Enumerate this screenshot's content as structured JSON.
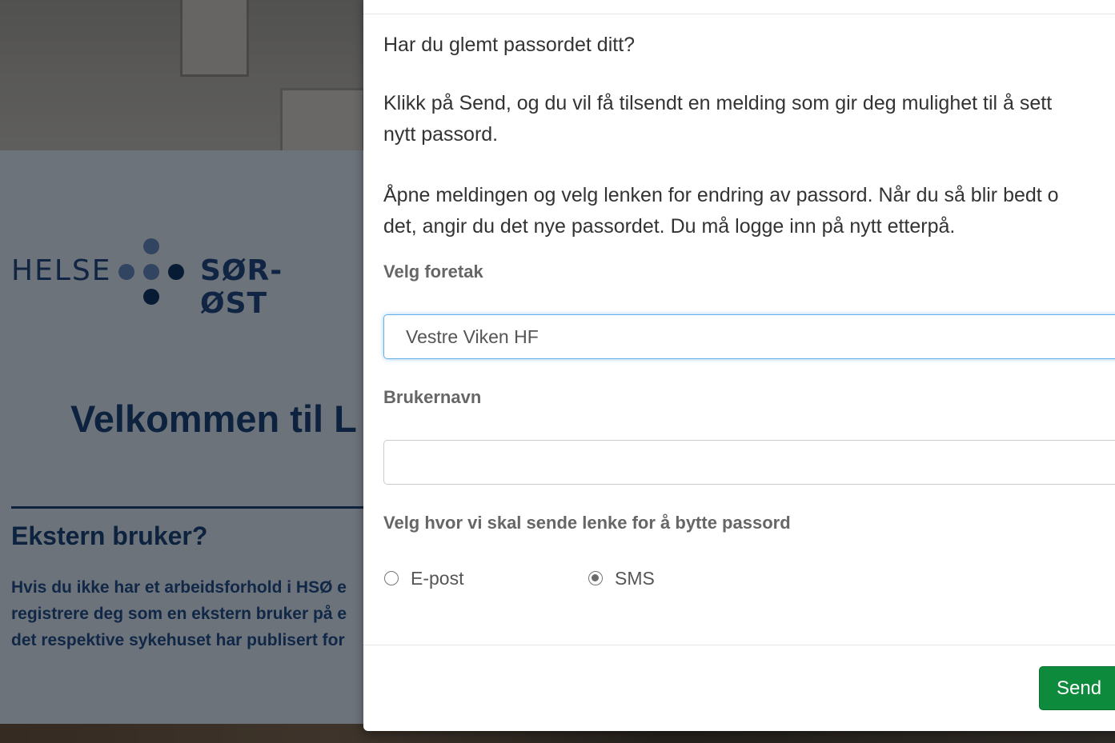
{
  "background": {
    "logo_left": "HELSE",
    "logo_right": "SØR-ØST",
    "welcome_heading": "Velkommen til L",
    "ekstern_heading": "Ekstern bruker?",
    "ekstern_lines": [
      "Hvis du ikke har et arbeidsforhold i HSØ e",
      "registrere deg som en ekstern bruker på e",
      "det respektive sykehuset har publisert for"
    ],
    "colors": {
      "brand_blue": "#153b6c",
      "logo_dot_dark": "#0f2f5c",
      "logo_dot_light": "#5577a5"
    }
  },
  "modal": {
    "question": "Har du glemt passordet ditt?",
    "paragraph1_line1": "Klikk på Send, og du vil få tilsendt en melding som gir deg mulighet til å sett",
    "paragraph1_line2": "nytt passord.",
    "paragraph2_line1": "Åpne meldingen og velg lenken for endring av passord. Når du så blir bedt o",
    "paragraph2_line2": "det, angir du det nye passordet. Du må logge inn på nytt etterpå.",
    "foretak_label": "Velg foretak",
    "foretak_value": "Vestre Viken HF",
    "username_label": "Brukernavn",
    "username_value": "",
    "send_method_label": "Velg hvor vi skal sende lenke for å bytte passord",
    "send_options": [
      {
        "label": "E-post",
        "checked": false
      },
      {
        "label": "SMS",
        "checked": true
      }
    ],
    "send_button": "Send",
    "colors": {
      "send_button": "#0d8a3b",
      "focus_border": "#66afe9"
    }
  }
}
